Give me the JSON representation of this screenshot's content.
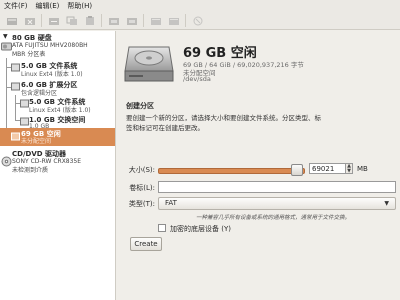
{
  "menubar": {
    "items": [
      "文件(F)",
      "编辑(E)",
      "帮助(H)"
    ]
  },
  "toolbar": {
    "icons": [
      "add-partition-icon",
      "delete-icon",
      "resize-icon",
      "copy-icon",
      "paste-icon",
      "undo-icon",
      "apply-icon",
      "settings-icon",
      "info-icon",
      "help-icon"
    ]
  },
  "tree": {
    "disk": {
      "title": "80 GB 硬盘",
      "sub1": "ATA FUJITSU MHV2080BH",
      "sub2": "MBR 分区表"
    },
    "nodes": [
      {
        "title": "5.0 GB 文件系统",
        "sub": "Linux Ext4 (版本 1.0)"
      },
      {
        "title": "6.0 GB 扩展分区",
        "sub": "包含逻辑分区"
      },
      {
        "title": "5.0 GB 文件系统",
        "sub": "Linux Ext4 (版本 1.0)"
      },
      {
        "title": "1.0 GB 交换空间",
        "sub": "1.0 GB"
      },
      {
        "title": "69 GB 空闲",
        "sub": "未分配空间"
      }
    ],
    "cdrom": {
      "title": "CD/DVD 驱动器",
      "sub1": "SONY CD-RW  CRX835E",
      "sub2": "未检测到介质"
    }
  },
  "device": {
    "title": "69 GB 空闲",
    "size_line": "69 GB / 64 GiB / 69,020,937,216 字节",
    "status": "未分配空间",
    "path": "/dev/sda"
  },
  "create": {
    "section_title": "创建分区",
    "description": "要创建一个新的分区，请选择大小和要创建文件系统。分区类型、标签和标记可在创建后更改。",
    "size_label": "大小(S):",
    "size_value": "69021",
    "size_unit": "MB",
    "size_fraction": 1.0,
    "label_label": "卷标(L):",
    "label_value": "",
    "type_label": "类型(T):",
    "type_value": "FAT",
    "note": "一种兼容几乎所有设备或系统的通用格式，通常用于文件交换。",
    "encrypt_label": "加密的底层设备 (Y)",
    "encrypt_checked": false,
    "create_button": "Create"
  }
}
